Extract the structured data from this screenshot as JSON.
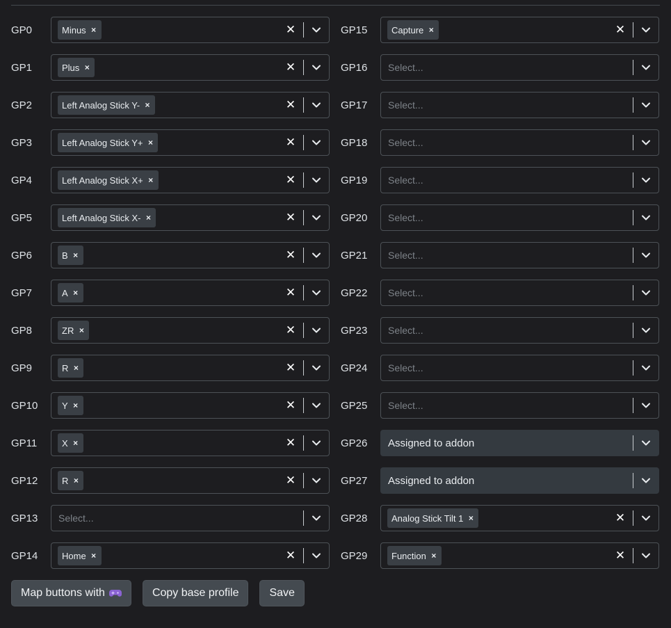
{
  "icons": {
    "remove": "×",
    "clear": "✕",
    "chevron": "chevron-down-icon",
    "gamepad": "gamepad-icon"
  },
  "colors": {
    "background": "#1d1d20",
    "chip": "#3a3f45",
    "assigned": "#343a40",
    "button": "#444a50",
    "gamepad_accent": "#8a63d2"
  },
  "placeholder": "Select...",
  "left_column": [
    {
      "pin": "GP0",
      "chips": [
        "Minus"
      ]
    },
    {
      "pin": "GP1",
      "chips": [
        "Plus"
      ]
    },
    {
      "pin": "GP2",
      "chips": [
        "Left Analog Stick Y-"
      ]
    },
    {
      "pin": "GP3",
      "chips": [
        "Left Analog Stick Y+"
      ]
    },
    {
      "pin": "GP4",
      "chips": [
        "Left Analog Stick X+"
      ]
    },
    {
      "pin": "GP5",
      "chips": [
        "Left Analog Stick X-"
      ]
    },
    {
      "pin": "GP6",
      "chips": [
        "B"
      ]
    },
    {
      "pin": "GP7",
      "chips": [
        "A"
      ]
    },
    {
      "pin": "GP8",
      "chips": [
        "ZR"
      ]
    },
    {
      "pin": "GP9",
      "chips": [
        "R"
      ]
    },
    {
      "pin": "GP10",
      "chips": [
        "Y"
      ]
    },
    {
      "pin": "GP11",
      "chips": [
        "X"
      ]
    },
    {
      "pin": "GP12",
      "chips": [
        "R"
      ]
    },
    {
      "pin": "GP13",
      "chips": []
    },
    {
      "pin": "GP14",
      "chips": [
        "Home"
      ]
    }
  ],
  "right_column": [
    {
      "pin": "GP15",
      "chips": [
        "Capture"
      ]
    },
    {
      "pin": "GP16",
      "chips": []
    },
    {
      "pin": "GP17",
      "chips": []
    },
    {
      "pin": "GP18",
      "chips": []
    },
    {
      "pin": "GP19",
      "chips": []
    },
    {
      "pin": "GP20",
      "chips": []
    },
    {
      "pin": "GP21",
      "chips": []
    },
    {
      "pin": "GP22",
      "chips": []
    },
    {
      "pin": "GP23",
      "chips": []
    },
    {
      "pin": "GP24",
      "chips": []
    },
    {
      "pin": "GP25",
      "chips": []
    },
    {
      "pin": "GP26",
      "assigned": "Assigned to addon"
    },
    {
      "pin": "GP27",
      "assigned": "Assigned to addon"
    },
    {
      "pin": "GP28",
      "chips": [
        "Analog Stick Tilt 1"
      ]
    },
    {
      "pin": "GP29",
      "chips": [
        "Function"
      ]
    }
  ],
  "buttons": {
    "map_buttons": "Map buttons with",
    "copy_base_profile": "Copy base profile",
    "save": "Save"
  }
}
